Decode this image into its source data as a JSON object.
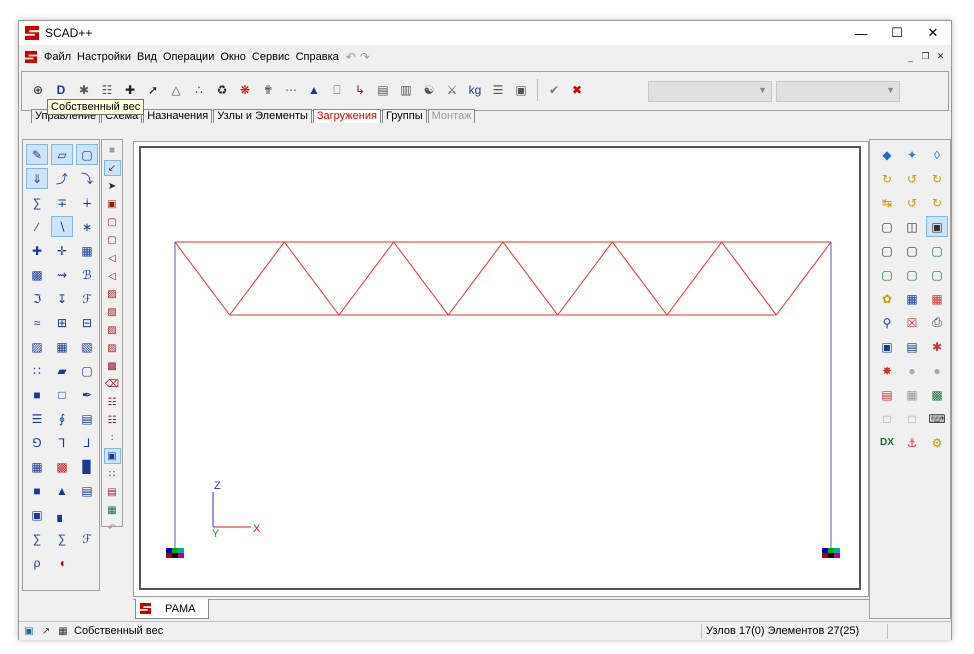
{
  "window": {
    "title": "SCAD++"
  },
  "menu": {
    "items": [
      "Файл",
      "Настройки",
      "Вид",
      "Операции",
      "Окно",
      "Сервис",
      "Справка"
    ]
  },
  "toolbar": {
    "tooltip": "Собственный вес",
    "icons": [
      "self-weight",
      "D",
      "load-1",
      "load-2",
      "load-3",
      "load-4",
      "load-5",
      "load-6",
      "load-7",
      "load-8",
      "load-9",
      "load-10",
      "load-11",
      "load-12",
      "load-13",
      "load-14",
      "load-15",
      "load-16",
      "load-17",
      "kg",
      "load-18",
      "load-19"
    ],
    "apply_icon": "checkmark-icon",
    "cancel_icon": "cross-icon"
  },
  "tabs": [
    {
      "label": "Управление",
      "state": "normal"
    },
    {
      "label": "Схема",
      "state": "normal"
    },
    {
      "label": "Назначения",
      "state": "normal"
    },
    {
      "label": "Узлы и Элементы",
      "state": "normal"
    },
    {
      "label": "Загружения",
      "state": "active"
    },
    {
      "label": "Группы",
      "state": "normal"
    },
    {
      "label": "Монтаж",
      "state": "disabled"
    }
  ],
  "canvas": {
    "axes": {
      "z": "Z",
      "y": "Y",
      "x": "X"
    },
    "colors": {
      "truss": "#e8302a",
      "columns": "#5a5aa8"
    }
  },
  "document_tab": {
    "label": "РАМА"
  },
  "status": {
    "left_text": "Собственный вес",
    "right_text": "Узлов 17(0) Элементов 27(25)"
  },
  "colors": {
    "accent_red": "#d00000",
    "selection": "#cde4f7"
  }
}
